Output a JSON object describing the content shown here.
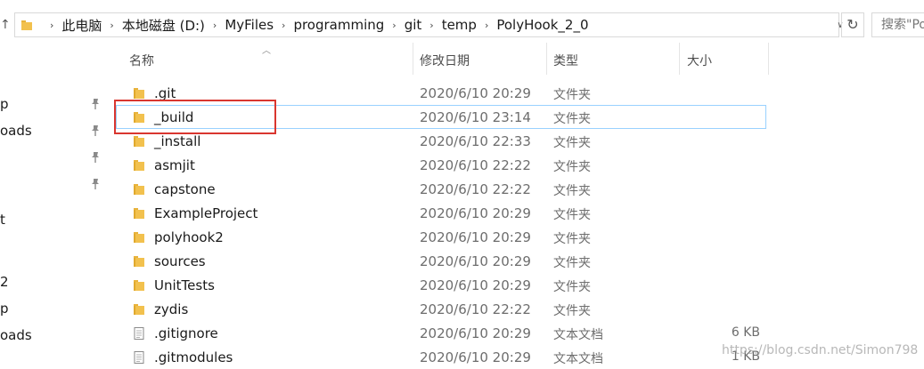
{
  "address": {
    "crumbs": [
      "此电脑",
      "本地磁盘 (D:)",
      "MyFiles",
      "programming",
      "git",
      "temp",
      "PolyHook_2_0"
    ],
    "search_placeholder": "搜索\"Po"
  },
  "columns": {
    "name": "名称",
    "date": "修改日期",
    "type": "类型",
    "size": "大小"
  },
  "nav": {
    "items": [
      {
        "label": "p",
        "pinned": true
      },
      {
        "label": "oads",
        "pinned": true
      },
      {
        "label": "",
        "pinned": true
      },
      {
        "label": "",
        "pinned": true
      },
      {
        "label": "t",
        "pinned": false
      },
      {
        "label": "2",
        "pinned": false
      },
      {
        "label": "p",
        "pinned": false
      },
      {
        "label": "oads",
        "pinned": false
      }
    ]
  },
  "files": [
    {
      "name": ".git",
      "date": "2020/6/10 20:29",
      "type": "文件夹",
      "size": "",
      "kind": "folder"
    },
    {
      "name": "_build",
      "date": "2020/6/10 23:14",
      "type": "文件夹",
      "size": "",
      "kind": "folder",
      "selected": true
    },
    {
      "name": "_install",
      "date": "2020/6/10 22:33",
      "type": "文件夹",
      "size": "",
      "kind": "folder"
    },
    {
      "name": "asmjit",
      "date": "2020/6/10 22:22",
      "type": "文件夹",
      "size": "",
      "kind": "folder"
    },
    {
      "name": "capstone",
      "date": "2020/6/10 22:22",
      "type": "文件夹",
      "size": "",
      "kind": "folder"
    },
    {
      "name": "ExampleProject",
      "date": "2020/6/10 20:29",
      "type": "文件夹",
      "size": "",
      "kind": "folder"
    },
    {
      "name": "polyhook2",
      "date": "2020/6/10 20:29",
      "type": "文件夹",
      "size": "",
      "kind": "folder"
    },
    {
      "name": "sources",
      "date": "2020/6/10 20:29",
      "type": "文件夹",
      "size": "",
      "kind": "folder"
    },
    {
      "name": "UnitTests",
      "date": "2020/6/10 20:29",
      "type": "文件夹",
      "size": "",
      "kind": "folder"
    },
    {
      "name": "zydis",
      "date": "2020/6/10 22:22",
      "type": "文件夹",
      "size": "",
      "kind": "folder"
    },
    {
      "name": ".gitignore",
      "date": "2020/6/10 20:29",
      "type": "文本文档",
      "size": "6 KB",
      "kind": "file"
    },
    {
      "name": ".gitmodules",
      "date": "2020/6/10 20:29",
      "type": "文本文档",
      "size": "1 KB",
      "kind": "file"
    }
  ],
  "watermark": "https://blog.csdn.net/Simon798",
  "colors": {
    "folder": "#f2c14e",
    "selection_border": "#99d1ff",
    "highlight": "#d9362f"
  }
}
